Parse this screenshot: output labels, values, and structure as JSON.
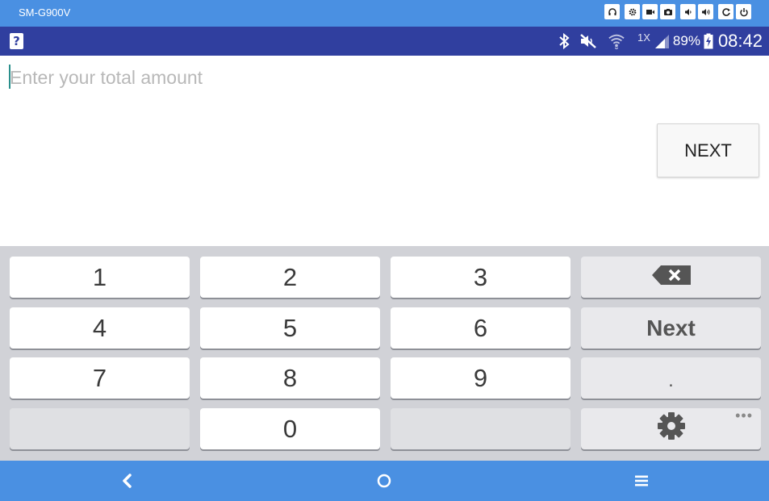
{
  "device": {
    "name": "SM-G900V",
    "controls": [
      "headphones-icon",
      "gear-icon",
      "video-camera-icon",
      "camera-icon",
      "volume-down-icon",
      "volume-up-icon",
      "refresh-icon",
      "power-icon"
    ]
  },
  "status_bar": {
    "help_label": "?",
    "network_type": "1X",
    "battery_percent": "89%",
    "time": "08:42",
    "icons": [
      "bluetooth-icon",
      "mute-icon",
      "wifi-icon",
      "cell-signal-icon",
      "battery-charging-icon"
    ]
  },
  "form": {
    "amount_placeholder": "Enter your total amount",
    "amount_value": "",
    "next_label": "NEXT"
  },
  "keyboard": {
    "keys": {
      "k1": "1",
      "k2": "2",
      "k3": "3",
      "k4": "4",
      "k5": "5",
      "k6": "6",
      "k7": "7",
      "k8": "8",
      "k9": "9",
      "k0": "0"
    },
    "next_label": "Next",
    "dot_label": ".",
    "more_label": "•••"
  },
  "nav": {
    "icons": [
      "back-icon",
      "home-icon",
      "menu-icon"
    ]
  },
  "colors": {
    "device_bar": "#4a90e2",
    "status_bar": "#303f9f",
    "keyboard_bg": "#d1d2d7",
    "cursor": "#2a8f8c"
  }
}
